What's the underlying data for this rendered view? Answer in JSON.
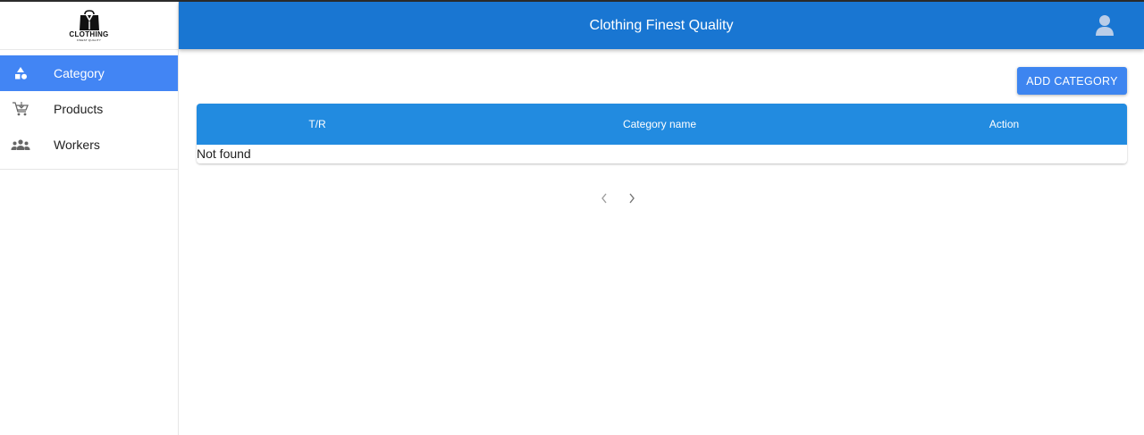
{
  "app": {
    "logo_text": "CLOTHING",
    "logo_subtext": "FINEST QUALITY",
    "title": "Clothing Finest Quality"
  },
  "sidebar": {
    "items": [
      {
        "label": "Category",
        "icon": "shapes-icon",
        "active": true
      },
      {
        "label": "Products",
        "icon": "cart-icon",
        "active": false
      },
      {
        "label": "Workers",
        "icon": "group-icon",
        "active": false
      }
    ]
  },
  "toolbar": {
    "add_label": "ADD CATEGORY"
  },
  "table": {
    "columns": [
      "T/R",
      "Category name",
      "Action"
    ],
    "empty_text": "Not found"
  },
  "pagination": {
    "prev_icon": "chevron-left-icon",
    "next_icon": "chevron-right-icon"
  },
  "colors": {
    "header": "#1976d2",
    "table_header": "#228be0",
    "active_nav": "#4285f4",
    "button": "#3d85f0"
  }
}
